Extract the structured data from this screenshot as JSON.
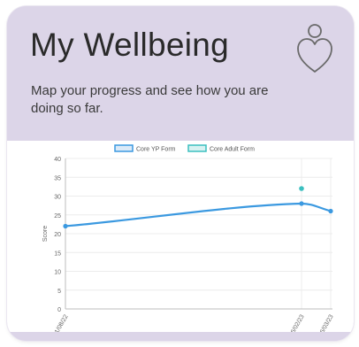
{
  "header": {
    "title": "My Wellbeing",
    "subtitle": "Map your progress and see how you are doing so far.",
    "icon": "heart-outline-icon"
  },
  "colors": {
    "card_bg": "#dcd5e8",
    "series_yp": "#3b99e0",
    "series_adult": "#3bbfbf"
  },
  "chart_data": {
    "type": "line",
    "legend": [
      "Core YP Form",
      "Core Adult Form"
    ],
    "ylabel": "Score",
    "xlabel": "",
    "ylim": [
      0,
      40
    ],
    "yticks": [
      0,
      5,
      10,
      15,
      20,
      25,
      30,
      35,
      40
    ],
    "x": [
      "31/08/22",
      "16/02/23",
      "06/03/23"
    ],
    "series": [
      {
        "name": "Core YP Form",
        "color": "#3b99e0",
        "values": [
          22,
          28,
          26
        ]
      },
      {
        "name": "Core Adult Form",
        "color": "#3bbfbf",
        "values": [
          null,
          32,
          null
        ]
      }
    ],
    "grid": true,
    "legend_position": "top"
  }
}
